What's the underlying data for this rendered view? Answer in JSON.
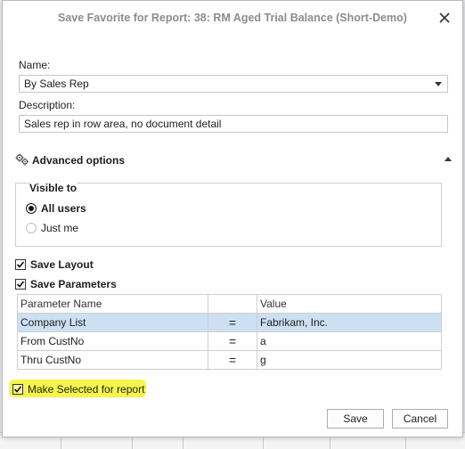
{
  "dialog": {
    "title": "Save Favorite for Report: 38: RM Aged Trial Balance (Short-Demo)"
  },
  "form": {
    "name_label": "Name:",
    "name_value": "By Sales Rep",
    "description_label": "Description:",
    "description_value": "Sales rep in row area, no document detail"
  },
  "advanced": {
    "label": "Advanced options",
    "visible_to": {
      "label": "Visible to",
      "options": [
        "All users",
        "Just me"
      ],
      "selected": "All users"
    },
    "save_layout": {
      "label": "Save Layout",
      "checked": true
    },
    "save_parameters": {
      "label": "Save Parameters",
      "checked": true
    },
    "parameters_table": {
      "columns": [
        "Parameter Name",
        "",
        "Value"
      ],
      "rows": [
        {
          "name": "Company List",
          "op": "=",
          "value": "Fabrikam, Inc.",
          "selected": true
        },
        {
          "name": "From CustNo",
          "op": "=",
          "value": "a",
          "selected": false
        },
        {
          "name": "Thru CustNo",
          "op": "=",
          "value": "g",
          "selected": false
        }
      ]
    },
    "make_selected": {
      "label": "Make Selected for report",
      "checked": true
    }
  },
  "buttons": {
    "save": "Save",
    "cancel": "Cancel"
  },
  "colors": {
    "selection": "#cde0f3",
    "highlight": "#f6f43a",
    "title_text": "#8c8c8c"
  }
}
